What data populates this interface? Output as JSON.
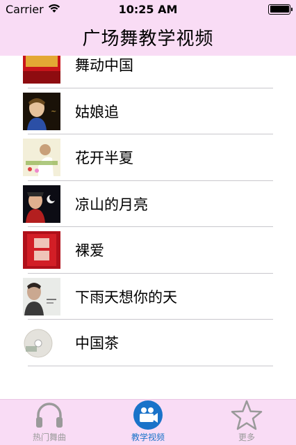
{
  "status": {
    "carrier": "Carrier",
    "time": "10:25 AM"
  },
  "navbar": {
    "title": "广场舞教学视频"
  },
  "videos": [
    {
      "title": "舞动中国"
    },
    {
      "title": "姑娘追"
    },
    {
      "title": "花开半夏"
    },
    {
      "title": "凉山的月亮"
    },
    {
      "title": "裸爱"
    },
    {
      "title": "下雨天想你的天"
    },
    {
      "title": "中国茶"
    }
  ],
  "tabs": [
    {
      "label": "热门舞曲",
      "icon": "headphones-icon",
      "active": false
    },
    {
      "label": "教学视频",
      "icon": "video-camera-icon",
      "active": true
    },
    {
      "label": "更多",
      "icon": "star-icon",
      "active": false
    }
  ],
  "colors": {
    "bar_background": "#f9dcf5",
    "active_tab": "#1a73c9",
    "inactive_tab": "#9a9a9a"
  }
}
